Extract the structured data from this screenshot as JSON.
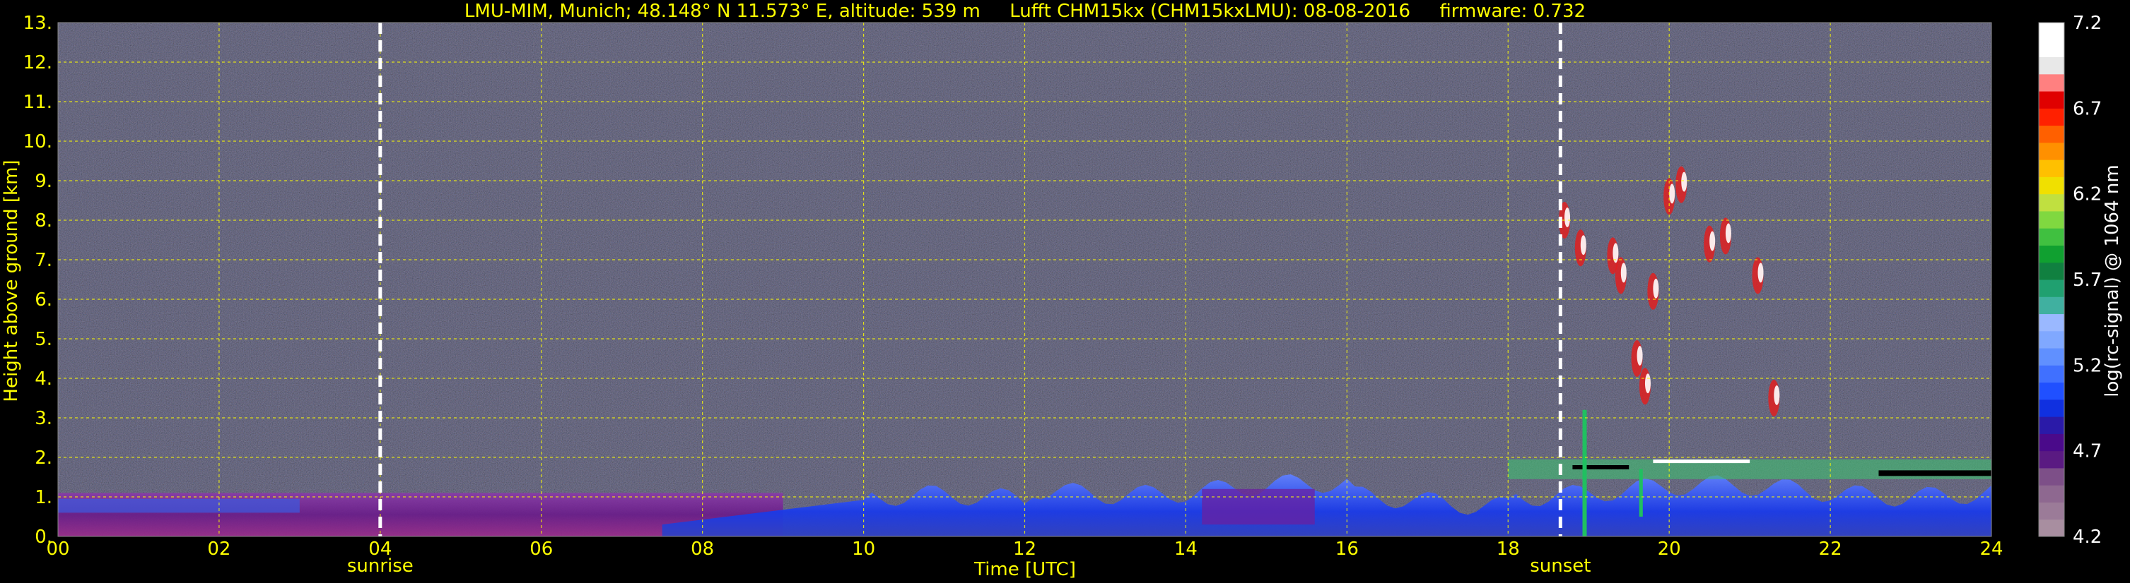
{
  "chart_data": {
    "type": "heatmap",
    "title": "LMU-MIM, Munich; 48.148° N 11.573° E, altitude: 539 m     Lufft CHM15kx (CHM15kxLMU): 08-08-2016     firmware: 0.732",
    "xlabel": "Time [UTC]",
    "ylabel": "Height above ground [km]",
    "xlim": [
      0,
      24
    ],
    "ylim": [
      0,
      13
    ],
    "x_ticks": [
      "00",
      "02",
      "04",
      "06",
      "08",
      "10",
      "12",
      "14",
      "16",
      "18",
      "20",
      "22",
      "24"
    ],
    "y_ticks": [
      "0.",
      "1.",
      "2.",
      "3.",
      "4.",
      "5.",
      "6.",
      "7.",
      "8.",
      "9.",
      "10.",
      "11.",
      "12.",
      "13."
    ],
    "grid": true,
    "events": [
      {
        "label": "sunrise",
        "time": 4.0
      },
      {
        "label": "sunset",
        "time": 18.65
      }
    ],
    "colorbar": {
      "label": "log(rc-signal) @ 1064 nm",
      "ticks": [
        "4.2",
        "4.7",
        "5.2",
        "5.7",
        "6.2",
        "6.7",
        "7.2"
      ],
      "range": [
        4.2,
        7.2
      ],
      "colors": [
        "#a88ea0",
        "#9b7b98",
        "#8e6890",
        "#7d4f88",
        "#5a1a82",
        "#4a0a8a",
        "#2a1aa8",
        "#1030e0",
        "#2050ff",
        "#4070ff",
        "#6090ff",
        "#80a8ff",
        "#9ab8ff",
        "#40b0a0",
        "#20a070",
        "#108040",
        "#10a030",
        "#40c040",
        "#80d840",
        "#c0e040",
        "#f0e000",
        "#ffc000",
        "#ff9000",
        "#ff6000",
        "#ff2000",
        "#e00000",
        "#ff8080",
        "#e8e8e8",
        "#ffffff",
        "#ffffff"
      ]
    },
    "layers": [
      {
        "name": "boundary layer",
        "t_start": 0,
        "t_end": 24,
        "height_top_km": 1.1
      },
      {
        "name": "cirrus",
        "t_start": 18.6,
        "t_end": 21.3,
        "height_range_km": [
          2.0,
          9.2
        ]
      },
      {
        "name": "cloud tops",
        "t_start": 18.0,
        "t_end": 24,
        "height_km": 1.7
      }
    ],
    "colors": {
      "axes_text": "#ffff00",
      "grid": "#ffff00",
      "background": "#000000",
      "noise": "#5a4a72"
    }
  }
}
